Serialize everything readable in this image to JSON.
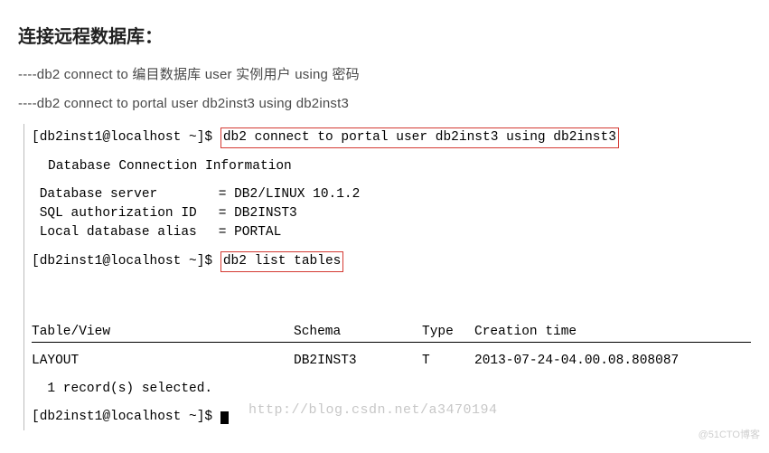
{
  "heading": "连接远程数据库：",
  "lines": {
    "template": "----db2 connect to 编目数据库 user 实例用户 using 密码",
    "example": "----db2 connect to portal user db2inst3 using db2inst3"
  },
  "terminal": {
    "prompt1_user": "[db2inst1@localhost ~]$ ",
    "cmd1": "db2 connect to portal user db2inst3 using db2inst3",
    "conn_info_title": "Database Connection Information",
    "rows": [
      {
        "label": "Database server",
        "value": "= DB2/LINUX 10.1.2"
      },
      {
        "label": "SQL authorization ID",
        "value": "= DB2INST3"
      },
      {
        "label": "Local database alias",
        "value": "= PORTAL"
      }
    ],
    "prompt2_user": "[db2inst1@localhost ~]$ ",
    "cmd2": "db2 list tables",
    "watermark": "http://blog.csdn.net/a3470194",
    "table": {
      "headers": {
        "c1": "Table/View",
        "c2": "Schema",
        "c3": "Type",
        "c4": "Creation time"
      },
      "row": {
        "c1": "LAYOUT",
        "c2": "DB2INST3",
        "c3": "T",
        "c4": "2013-07-24-04.00.08.808087"
      }
    },
    "records_line": "  1 record(s) selected.",
    "prompt3_user": "[db2inst1@localhost ~]$ "
  },
  "footer": "@51CTO博客"
}
